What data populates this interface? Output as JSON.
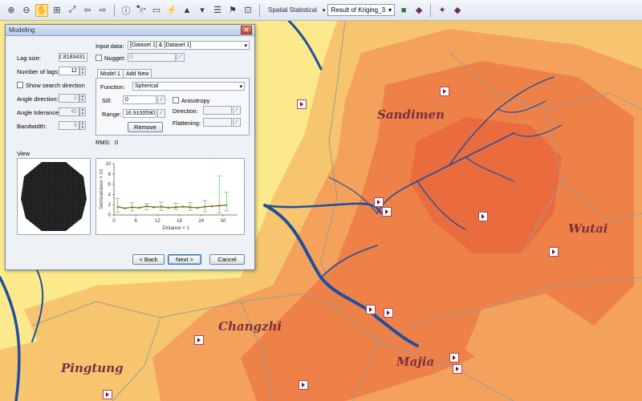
{
  "toolbar": {
    "buttons": [
      "zoom-in-icon",
      "zoom-out-icon",
      "pan-hand-icon",
      "full-extent-icon",
      "fixed-zoom-icon",
      "back-arrow-icon",
      "forward-arrow-icon",
      "identify-icon",
      "find-icon",
      "measure-icon",
      "hyperlink-icon",
      "select-features-icon",
      "clear-selection-icon",
      "html-popup-icon"
    ],
    "extension_label": "Spatial Statistical",
    "result_layer": "Result of Kriging_3"
  },
  "map": {
    "place_labels": [
      "Sandimen",
      "Wutai",
      "Changzhi",
      "Pingtung",
      "Majia"
    ],
    "colors": {
      "lightest": "#fbe98c",
      "light": "#f7c56e",
      "mid": "#f3a15b",
      "strong": "#ee8147",
      "core": "#ea6c3e",
      "river": "#1f4f9e",
      "boundary": "#a09a97"
    }
  },
  "dialog": {
    "title": "Modeling",
    "input_data_label": "Input data:",
    "input_data_value": "[Dataset 1] & [Dataset 1]",
    "lag_size_label": "Lag size:",
    "lag_size_value": "2.8183431",
    "number_of_lags_label": "Number of lags:",
    "number_of_lags_value": "12",
    "nugget_label": "Nugget:",
    "nugget_value": "0",
    "show_search_direction_label": "Show search direction",
    "angle_direction_label": "Angle direction:",
    "angle_direction_value": "0",
    "angle_tolerance_label": "Angle tolerance:",
    "angle_tolerance_value": "45",
    "bandwidth_label": "Bandwidth:",
    "bandwidth_value": "6",
    "tabs": [
      "Model 1",
      "Add New"
    ],
    "function_label": "Function:",
    "function_value": "Spherical",
    "sill_label": "Sill:",
    "sill_value": "0",
    "range_label": "Range:",
    "range_value": "16.9100590",
    "anisotropy_label": "Anisotropy",
    "direction_label": "Direction:",
    "flattening_label": "Flattening:",
    "remove_button": "Remove",
    "rms_label": "RMS:",
    "rms_value": "0",
    "view_label": "View",
    "back_button": "< Back",
    "next_button": "Next >",
    "cancel_button": "Cancel"
  },
  "chart_data": {
    "type": "line",
    "xlabel": "Distance × 1",
    "ylabel": "Semivariance × 10",
    "x_ticks": [
      0,
      6,
      12,
      18,
      24,
      30
    ],
    "y_ticks": [
      0,
      2,
      4,
      6,
      8,
      10
    ],
    "xlim": [
      0,
      34
    ],
    "ylim": [
      0,
      10
    ],
    "series": [
      {
        "x": [
          1,
          3,
          5,
          7,
          9,
          11,
          13,
          15,
          17,
          19,
          21,
          23,
          25,
          27,
          29,
          31
        ],
        "values": [
          1.6,
          1.3,
          1.5,
          1.4,
          1.7,
          1.5,
          1.6,
          1.4,
          1.5,
          1.6,
          1.5,
          1.4,
          1.6,
          1.7,
          1.8,
          1.9
        ]
      }
    ],
    "error_bars": [
      [
        1,
        3.2,
        0.5
      ],
      [
        5,
        2.4,
        0.8
      ],
      [
        9,
        2.2,
        1.0
      ],
      [
        13,
        2.5,
        0.9
      ],
      [
        17,
        2.3,
        1.0
      ],
      [
        21,
        2.4,
        0.9
      ],
      [
        25,
        2.8,
        0.6
      ],
      [
        29,
        7.6,
        0.4
      ],
      [
        31,
        4.4,
        0.8
      ]
    ],
    "model_curve_color": "#8b5a12",
    "points_color": "#7fd87f",
    "grid": false
  }
}
